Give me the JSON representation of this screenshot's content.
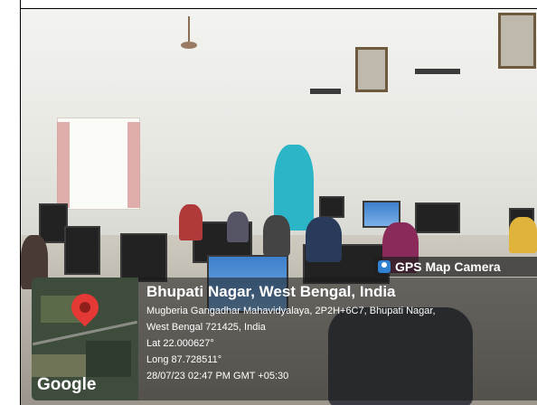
{
  "gps_camera": {
    "app_name": "GPS Map Camera",
    "place": "Bhupati Nagar, West Bengal, India",
    "address_line1": "Mugberia Gangadhar Mahavidyalaya, 2P2H+6C7, Bhupati Nagar,",
    "address_line2": "West Bengal 721425, India",
    "lat": "Lat 22.000627°",
    "long": "Long 87.728511°",
    "datetime": "28/07/23 02:47 PM GMT +05:30",
    "map_logo": "Google"
  },
  "icons": {
    "camera_app_icon": "gps-map-camera-icon",
    "location_pin": "map-pin-icon"
  },
  "colors": {
    "pin": "#e53935",
    "overlay": "#191919"
  }
}
